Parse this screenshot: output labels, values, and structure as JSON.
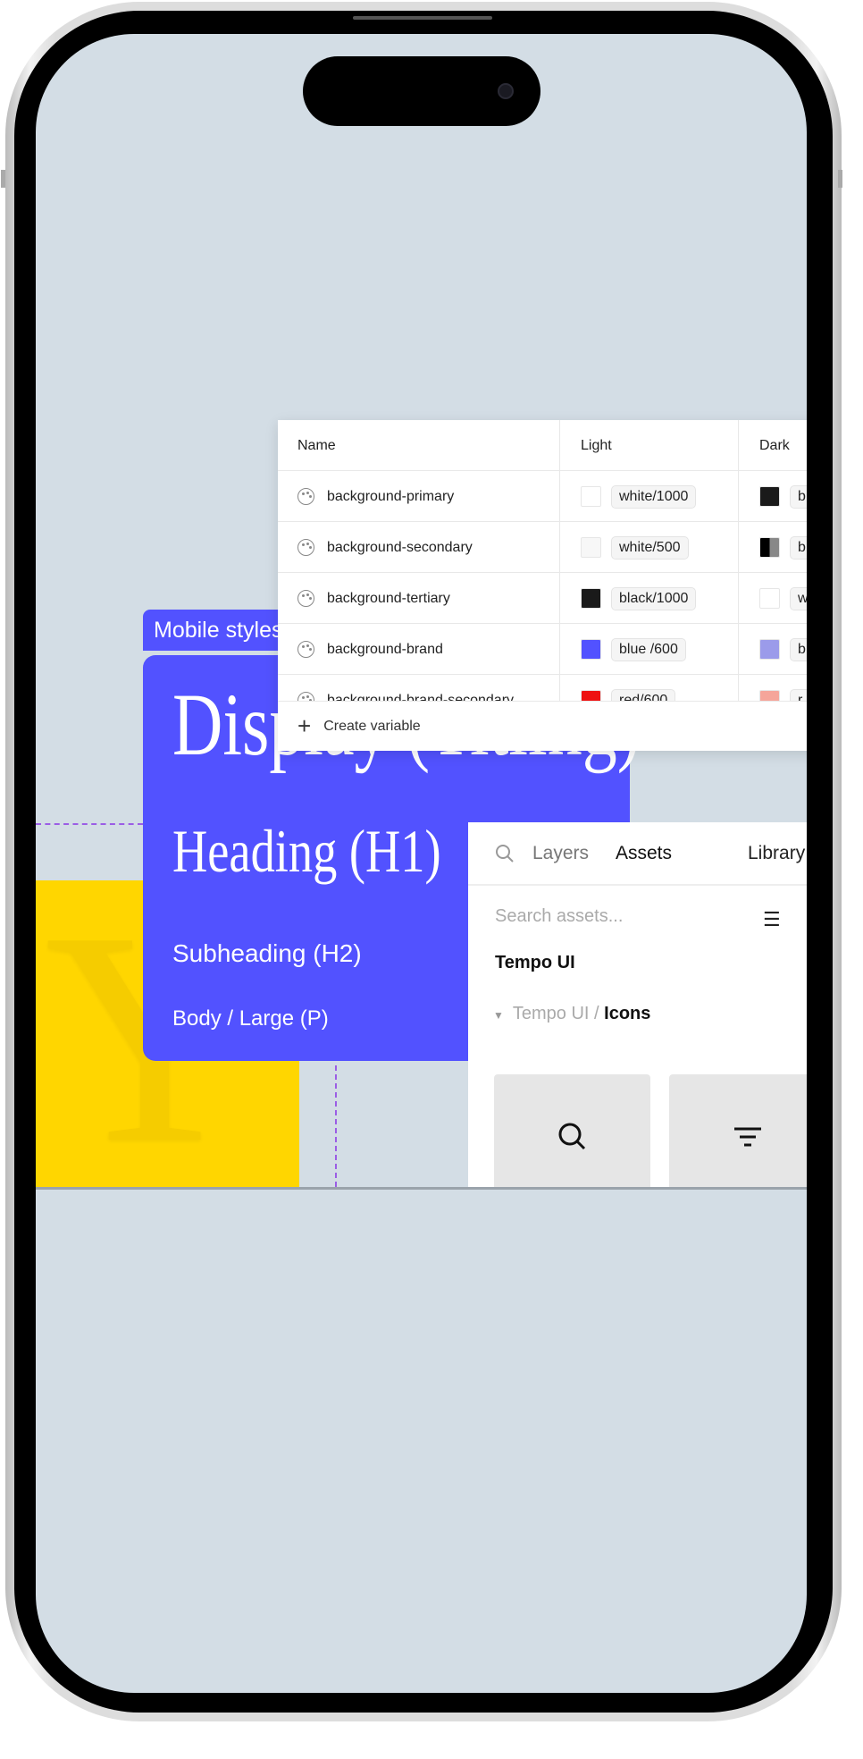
{
  "mobile_styles": {
    "label": "Mobile styles",
    "display": "Display (Titling)",
    "heading": "Heading (H1)",
    "subheading": "Subheading (H2)",
    "body": "Body / Large (P)",
    "card_color": "#5252ff"
  },
  "yellow_glyph": "Y",
  "variables_table": {
    "columns": [
      "Name",
      "Light",
      "Dark"
    ],
    "rows": [
      {
        "name": "background-primary",
        "light": "white/1000",
        "light_color": "#ffffff",
        "dark": "b",
        "dark_color": "#1a1a1a"
      },
      {
        "name": "background-secondary",
        "light": "white/500",
        "light_color": "#f7f7f7",
        "dark": "b",
        "dark_color": "#777777"
      },
      {
        "name": "background-tertiary",
        "light": "black/1000",
        "light_color": "#1a1a1a",
        "dark": "w",
        "dark_color": "#ffffff"
      },
      {
        "name": "background-brand",
        "light": "blue /600",
        "light_color": "#5252ff",
        "dark": "b",
        "dark_color": "#9b9bea"
      },
      {
        "name": "background-brand-secondary",
        "light": "red/600",
        "light_color": "#ee1111",
        "dark": "r",
        "dark_color": "#f5a59a"
      }
    ],
    "create_label": "Create variable"
  },
  "assets_panel": {
    "tabs": [
      "Layers",
      "Assets",
      "Library"
    ],
    "active_tab": "Assets",
    "search_placeholder": "Search assets...",
    "library_name": "Tempo UI",
    "path_parent": "Tempo UI / ",
    "path_current": "Icons",
    "icons": [
      "search-icon",
      "filter-icon"
    ]
  }
}
